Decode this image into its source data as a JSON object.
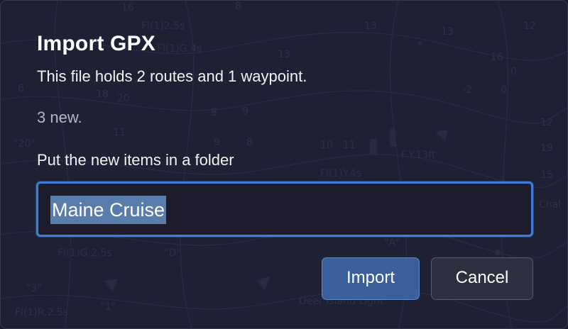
{
  "dialog": {
    "title": "Import GPX",
    "subtitle": "This file holds 2 routes and 1 waypoint.",
    "new_count": "3 new.",
    "folder_label": "Put the new items in a folder",
    "folder_value": "Maine Cruise",
    "import_label": "Import",
    "cancel_label": "Cancel"
  },
  "colors": {
    "accent": "#3d7ddb",
    "selection": "#5a7cab",
    "import_button": "#3a5f9a",
    "cancel_button": "#2e3040",
    "background": "#1d1f31"
  }
}
